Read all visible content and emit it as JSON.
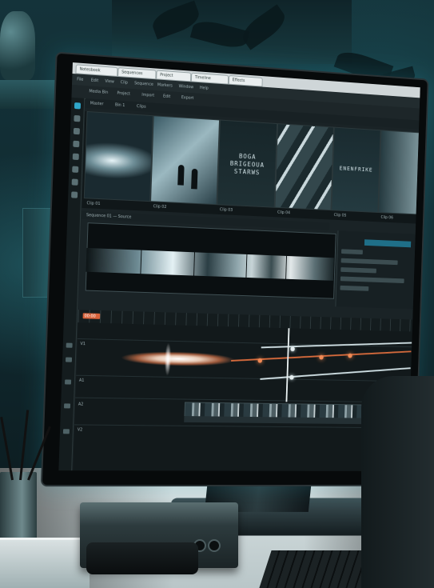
{
  "app": {
    "tabs": [
      "Notesbook",
      "Sequences",
      "Project",
      "Timeline",
      "Effects"
    ],
    "menu": [
      "File",
      "Edit",
      "View",
      "Clip",
      "Sequence",
      "Markers",
      "Window",
      "Help"
    ],
    "toolbar": [
      "Media Bin",
      "Project",
      "Import",
      "Edit",
      "Export"
    ]
  },
  "media": {
    "bins": [
      "Master",
      "Bin 1",
      "Clips"
    ],
    "thumb_labels": [
      "Clip 01",
      "Clip 02",
      "Clip 03",
      "Clip 04",
      "Clip 05",
      "Clip 06"
    ],
    "title_card": "BOGA\nBRIGEOUA\nSTARWS",
    "title_card_2": "ENENFRIKE"
  },
  "viewer": {
    "header": "Sequence 01 — Source"
  },
  "timeline": {
    "tracks": [
      "V1",
      "A1",
      "A2",
      "V2"
    ],
    "timecode": "00:00"
  },
  "icons": [
    "play-icon",
    "scissors-icon",
    "hand-icon",
    "zoom-icon",
    "marker-icon",
    "lock-icon",
    "eye-icon",
    "speaker-icon"
  ],
  "colors": {
    "accent": "#2fa6c9",
    "keyframe": "#f08a55",
    "bezel": "#070a0b"
  }
}
